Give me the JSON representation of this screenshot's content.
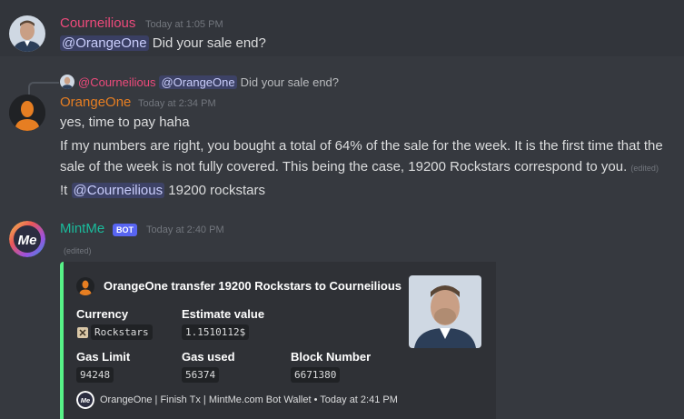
{
  "messages": [
    {
      "username": "Courneilious",
      "timestamp": "Today at 1:05 PM",
      "mention": "@OrangeOne",
      "text": " Did your sale end?",
      "name_color": "#ed4a7b"
    },
    {
      "reply": {
        "author": "@Courneilious",
        "mention": "@OrangeOne",
        "text": "Did your sale end?"
      },
      "username": "OrangeOne",
      "timestamp": "Today at 2:34 PM",
      "lines": [
        "yes, time to pay haha",
        "If my numbers are right, you bought a total of 64% of the sale for the week. It is the first time that the",
        "sale of the week is not fully covered. This being the case, 19200 Rockstars correspond to you."
      ],
      "edited": "(edited)",
      "cmd_prefix": "!t ",
      "cmd_mention": "@Courneilious",
      "cmd_suffix": " 19200 rockstars",
      "name_color": "#e67e22"
    },
    {
      "username": "MintMe",
      "bot_tag": "BOT",
      "timestamp": "Today at 2:40 PM",
      "edited": "(edited)",
      "name_color": "#1abc9c",
      "embed": {
        "title": "OrangeOne transfer 19200 Rockstars to Courneilious",
        "accent": "#57f287",
        "fields": [
          {
            "name": "Currency",
            "value": "Rockstars"
          },
          {
            "name": "Estimate value",
            "value": "1.1510112$"
          },
          {
            "name": "Gas Limit",
            "value": "94248"
          },
          {
            "name": "Gas used",
            "value": "56374"
          },
          {
            "name": "Block Number",
            "value": "6671380"
          }
        ],
        "footer": "OrangeOne | Finish Tx | MintMe.com Bot Wallet • Today at 2:41 PM"
      }
    }
  ]
}
